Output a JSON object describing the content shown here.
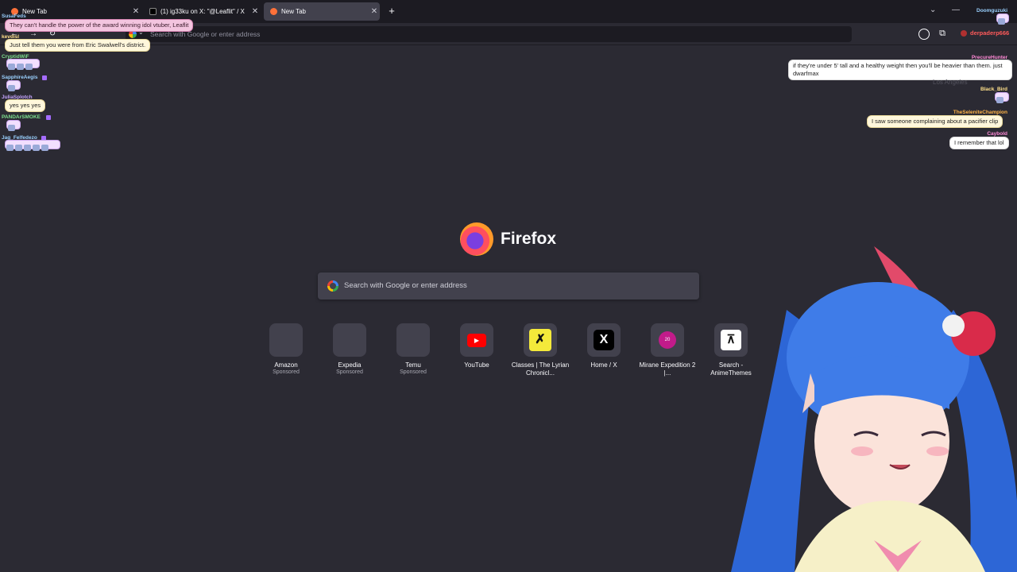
{
  "browser": {
    "tabs": [
      {
        "title": "New Tab",
        "close": "✕",
        "active": false
      },
      {
        "title": "(1) ig33ku on X: \"@Leaflit\" / X",
        "close": "✕",
        "active": false
      },
      {
        "title": "New Tab",
        "close": "✕",
        "active": true
      }
    ],
    "new_tab_symbol": "+",
    "window_controls": {
      "list": "⌄",
      "minimize": "—"
    },
    "urlbar_placeholder": "Search with Google or enter address",
    "account_name": "derpaderp666"
  },
  "newtab": {
    "brand": "Firefox",
    "search_placeholder": "Search with Google or enter address",
    "shortcuts": [
      {
        "name": "Amazon",
        "sponsored": "Sponsored",
        "icon": "blank"
      },
      {
        "name": "Expedia",
        "sponsored": "Sponsored",
        "icon": "blank"
      },
      {
        "name": "Temu",
        "sponsored": "Sponsored",
        "icon": "blank"
      },
      {
        "name": "YouTube",
        "sponsored": "",
        "icon": "youtube-icon",
        "glyph": "▶"
      },
      {
        "name": "Classes | The Lyrian Chronicl...",
        "sponsored": "",
        "icon": "lyrian-icon",
        "glyph": "✗"
      },
      {
        "name": "Home / X",
        "sponsored": "",
        "icon": "x-icon",
        "glyph": "X"
      },
      {
        "name": "Mirane Expedition 2 |...",
        "sponsored": "",
        "icon": "mirane-icon",
        "glyph": "20"
      },
      {
        "name": "Search - AnimeThemes",
        "sponsored": "",
        "icon": "animethemes-icon",
        "glyph": "⊼"
      }
    ]
  },
  "overlay": {
    "left_chat": [
      {
        "user": "SusaFeds",
        "message": "They can't handle the power of the award winning idol vtuber, Leaflit",
        "style": "pink"
      },
      {
        "user": "kevdisl",
        "message": "Just tell them you were from Eric Swalwell's district.",
        "style": "cream"
      },
      {
        "user": "CryptidWiF",
        "message": "",
        "style": "emotes"
      },
      {
        "user": "SapphireAegis",
        "message": "",
        "style": "emotes"
      },
      {
        "user": "JuliaSplotch",
        "message": "yes yes yes",
        "style": "cream"
      },
      {
        "user": "PANDArSMOKE",
        "message": "",
        "style": "emotes"
      },
      {
        "user": "Jag_Felfedezo",
        "message": "",
        "style": "emotes"
      }
    ],
    "right_chat": [
      {
        "user": "Doomguzuki",
        "message": "",
        "style": "emotes"
      },
      {
        "user": "PrecureHunter",
        "message": "if they're under 5' tall and a healthy weight then you'll be heavier than them. just dwarfmax",
        "style": "white"
      },
      {
        "user": "Black_Bird",
        "message": "",
        "style": "emotes"
      },
      {
        "user": "TheSeleniteChampion",
        "message": "I saw someone complaining about a pacifier clip",
        "style": "cream"
      },
      {
        "user": "Caybold",
        "message": "I remember that lol",
        "style": "white"
      }
    ],
    "ghost_city": "Los Angeles"
  }
}
